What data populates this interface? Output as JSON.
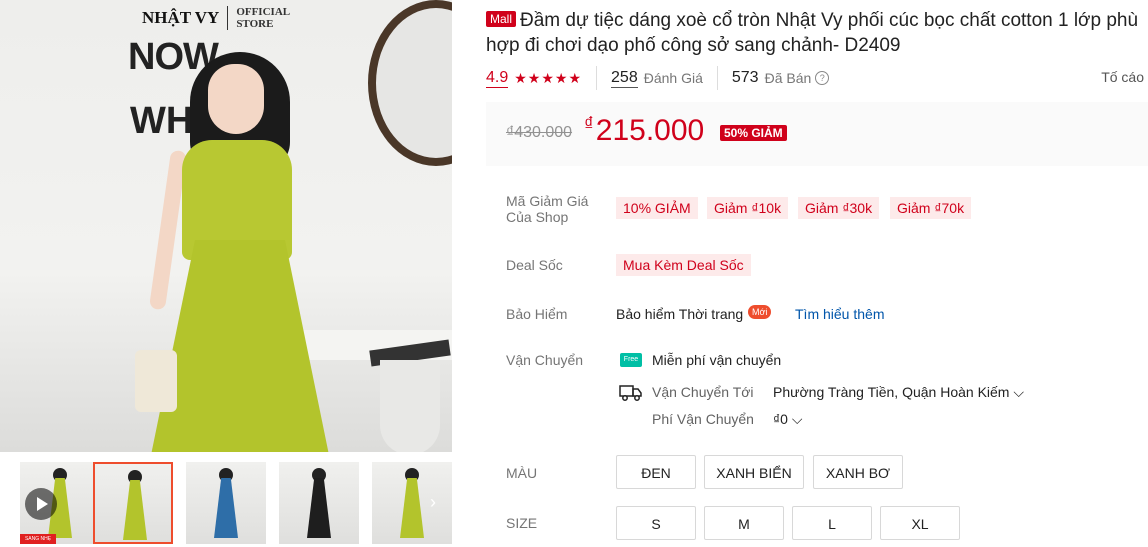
{
  "gallery": {
    "main_image_alt": "Woman in yellow-green flared dress",
    "logo_brand": "NHẬT VY",
    "logo_store_line1": "OFFICIAL",
    "logo_store_line2": "STORE",
    "thumbnails": [
      {
        "name": "video-thumb",
        "color": "#b3c42c",
        "has_play": true,
        "badge": "SANG NHẸ GIÁ TỐT"
      },
      {
        "name": "yellow-front",
        "color": "#b3c42c",
        "active": true
      },
      {
        "name": "blue",
        "color": "#2e6ea8"
      },
      {
        "name": "black",
        "color": "#1e1e1e"
      },
      {
        "name": "yellow-side",
        "color": "#b3c42c"
      }
    ]
  },
  "product": {
    "mall_badge": "Mall",
    "title": "Đầm dự tiệc dáng xoè cổ tròn Nhật Vy phối cúc bọc chất cotton 1 lớp phù hợp đi chơi dạo phố công sở sang chảnh- D2409",
    "rating": "4.9",
    "stars": "★★★★★",
    "reviews_count": "258",
    "reviews_label": "Đánh Giá",
    "sold_count": "573",
    "sold_label": "Đã Bán",
    "report_label": "Tố cáo"
  },
  "price": {
    "original": "₫430.000",
    "currency": "₫",
    "current": "215.000",
    "discount": "50% GIẢM"
  },
  "vouchers": {
    "label_line1": "Mã Giảm Giá",
    "label_line2": "Của Shop",
    "items": [
      "10% GIẢM",
      "Giảm ₫10k",
      "Giảm ₫30k",
      "Giảm ₫70k"
    ]
  },
  "deal": {
    "label": "Deal Sốc",
    "item": "Mua Kèm Deal Sốc"
  },
  "insurance": {
    "label": "Bảo Hiểm",
    "text": "Bảo hiểm Thời trang",
    "badge": "Mới",
    "link": "Tìm hiểu thêm"
  },
  "shipping": {
    "label": "Vận Chuyển",
    "free_icon_text": "Free",
    "free_text": "Miễn phí vận chuyển",
    "to_label": "Vận Chuyển Tới",
    "to_value": "Phường Tràng Tiền, Quận Hoàn Kiếm",
    "fee_label": "Phí Vận Chuyển",
    "fee_value": "₫0"
  },
  "variants": {
    "color_label": "MÀU",
    "colors": [
      "ĐEN",
      "XANH BIỂN",
      "XANH BƠ"
    ],
    "size_label": "SIZE",
    "sizes": [
      "S",
      "M",
      "L",
      "XL"
    ]
  }
}
